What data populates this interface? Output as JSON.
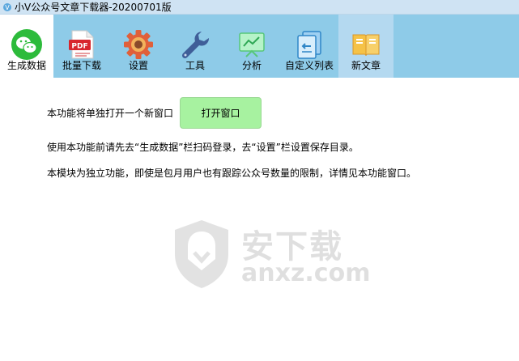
{
  "window": {
    "title": "小V公众号文章下载器-20200701版"
  },
  "toolbar": {
    "tabs": [
      {
        "label": "生成数据",
        "icon": "wechat-icon",
        "state": "active"
      },
      {
        "label": "批量下载",
        "icon": "pdf-icon",
        "state": "normal"
      },
      {
        "label": "设置",
        "icon": "gear-icon",
        "state": "normal"
      },
      {
        "label": "工具",
        "icon": "wrench-icon",
        "state": "normal"
      },
      {
        "label": "分析",
        "icon": "chart-icon",
        "state": "normal"
      },
      {
        "label": "自定义列表",
        "icon": "list-icon",
        "state": "normal"
      },
      {
        "label": "新文章",
        "icon": "book-icon",
        "state": "highlighted"
      }
    ]
  },
  "main": {
    "intro": "本功能将单独打开一个新窗口",
    "open_button": "打开窗口",
    "note1": "使用本功能前请先去“生成数据”栏扫码登录，去“设置”栏设置保存目录。",
    "note2": "本模块为独立功能，即使是包月用户也有跟踪公众号数量的限制，详情见本功能窗口。"
  },
  "watermark": {
    "text": "安下载",
    "sub": "anxz.com"
  },
  "colors": {
    "toolbar_bg": "#8ecbe8",
    "button_bg": "#a7f2a0",
    "wechat_green": "#2dbb3b"
  }
}
